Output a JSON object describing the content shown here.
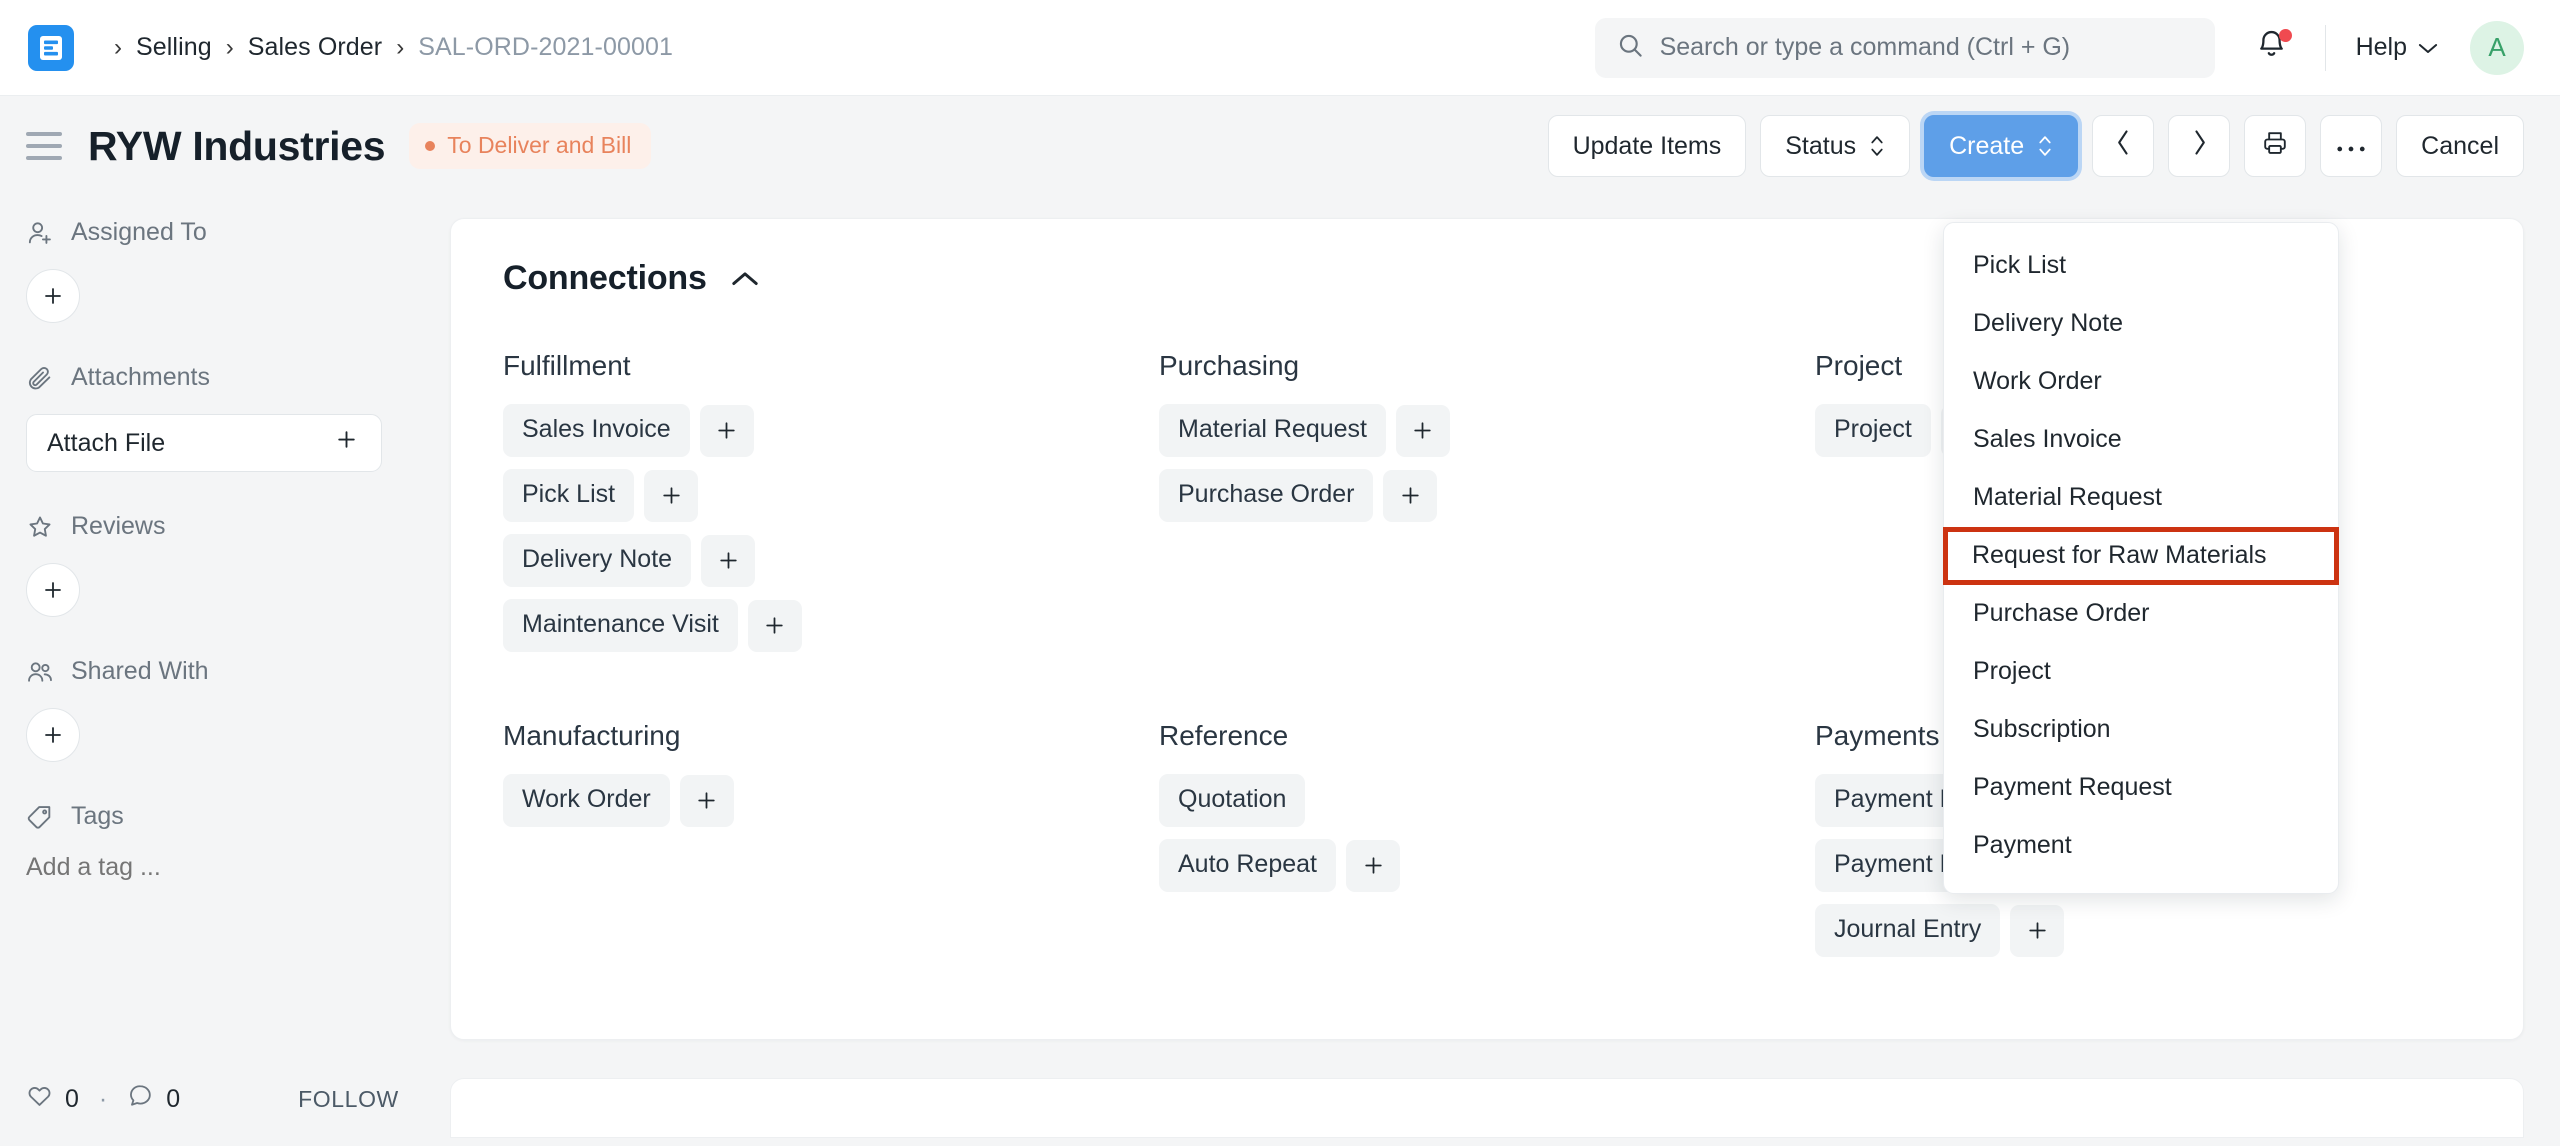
{
  "navbar": {
    "logo_name": "erpnext-logo",
    "breadcrumbs": [
      {
        "label": "Selling",
        "current": false
      },
      {
        "label": "Sales Order",
        "current": false
      },
      {
        "label": "SAL-ORD-2021-00001",
        "current": true
      }
    ],
    "separator": "›",
    "search": {
      "placeholder": "Search or type a command (Ctrl + G)",
      "value": "",
      "icon": "search-icon"
    },
    "notification": {
      "icon": "bell-icon",
      "has_unread": true,
      "dot_color": "#F04A50"
    },
    "help": {
      "label": "Help",
      "icon": "chevron-down-icon"
    },
    "avatar": {
      "initial": "A",
      "bg": "#DDF3E5",
      "fg": "#38A169"
    }
  },
  "page_head": {
    "menu_icon": "hamburger-icon",
    "title": "RYW Industries",
    "status": {
      "label": "To Deliver and Bill",
      "color": "#E8835C",
      "bg": "#FDF0EA"
    },
    "actions": {
      "update_items": "Update Items",
      "status": "Status",
      "create": "Create",
      "prev_icon": "chevron-left-icon",
      "next_icon": "chevron-right-icon",
      "print_icon": "printer-icon",
      "more_icon": "ellipsis-icon",
      "cancel": "Cancel"
    },
    "primary_color": "#5E9FE8"
  },
  "sidebar": {
    "assigned_to": {
      "label": "Assigned To",
      "icon": "user-plus-icon",
      "add_icon": "plus-icon"
    },
    "attachments": {
      "label": "Attachments",
      "icon": "paperclip-icon",
      "button": "Attach File",
      "add_icon": "plus-icon"
    },
    "reviews": {
      "label": "Reviews",
      "icon": "star-icon",
      "add_icon": "plus-icon"
    },
    "shared_with": {
      "label": "Shared With",
      "icon": "users-icon",
      "add_icon": "plus-icon"
    },
    "tags": {
      "label": "Tags",
      "icon": "tag-icon",
      "placeholder": "Add a tag ...",
      "value": ""
    },
    "footer": {
      "like_icon": "heart-icon",
      "like_count": "0",
      "separator": "·",
      "comment_icon": "comment-icon",
      "comment_count": "0",
      "follow": "FOLLOW"
    }
  },
  "connections": {
    "title": "Connections",
    "collapse_icon": "chevron-up-icon",
    "groups": [
      {
        "title": "Fulfillment",
        "items": [
          {
            "label": "Sales Invoice",
            "has_add": true
          },
          {
            "label": "Pick List",
            "has_add": true
          },
          {
            "label": "Delivery Note",
            "has_add": true
          },
          {
            "label": "Maintenance Visit",
            "has_add": true
          }
        ]
      },
      {
        "title": "Purchasing",
        "items": [
          {
            "label": "Material Request",
            "has_add": true
          },
          {
            "label": "Purchase Order",
            "has_add": true
          }
        ]
      },
      {
        "title": "Project",
        "items": [
          {
            "label": "Project",
            "has_add": true
          }
        ]
      },
      {
        "title": "Manufacturing",
        "items": [
          {
            "label": "Work Order",
            "has_add": true
          }
        ]
      },
      {
        "title": "Reference",
        "items": [
          {
            "label": "Quotation",
            "has_add": false
          },
          {
            "label": "Auto Repeat",
            "has_add": true
          }
        ]
      },
      {
        "title": "Payments",
        "items": [
          {
            "label": "Payment Entry",
            "has_add": true
          },
          {
            "label": "Payment Request",
            "has_add": true
          },
          {
            "label": "Journal Entry",
            "has_add": true
          }
        ]
      }
    ]
  },
  "create_dropdown": {
    "items": [
      {
        "label": "Pick List",
        "highlighted": false
      },
      {
        "label": "Delivery Note",
        "highlighted": false
      },
      {
        "label": "Work Order",
        "highlighted": false
      },
      {
        "label": "Sales Invoice",
        "highlighted": false
      },
      {
        "label": "Material Request",
        "highlighted": false
      },
      {
        "label": "Request for Raw Materials",
        "highlighted": true
      },
      {
        "label": "Purchase Order",
        "highlighted": false
      },
      {
        "label": "Project",
        "highlighted": false
      },
      {
        "label": "Subscription",
        "highlighted": false
      },
      {
        "label": "Payment Request",
        "highlighted": false
      },
      {
        "label": "Payment",
        "highlighted": false
      }
    ],
    "highlight_color": "#CC3311"
  }
}
